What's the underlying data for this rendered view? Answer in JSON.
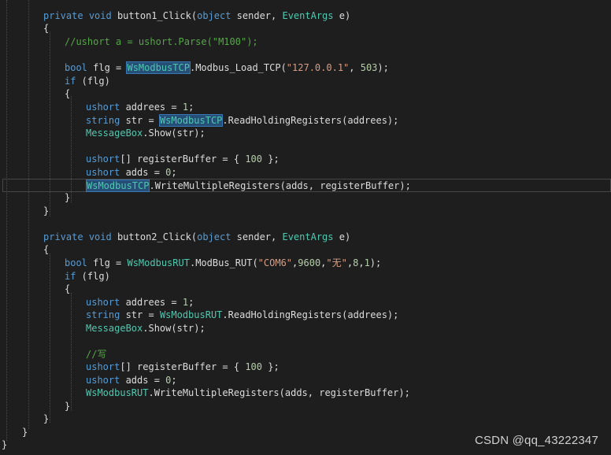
{
  "editor": {
    "lines": [
      [
        {
          "t": "private",
          "c": "kw"
        },
        {
          "t": " "
        },
        {
          "t": "void",
          "c": "kw"
        },
        {
          "t": " button1_Click("
        },
        {
          "t": "object",
          "c": "kw"
        },
        {
          "t": " sender, "
        },
        {
          "t": "EventArgs",
          "c": "ty"
        },
        {
          "t": " e)"
        }
      ],
      [
        {
          "t": "{"
        }
      ],
      [
        {
          "t": "//ushort a = ushort.Parse(\"M100\");",
          "c": "cm"
        }
      ],
      [],
      [
        {
          "t": "bool",
          "c": "kw"
        },
        {
          "t": " flg = "
        },
        {
          "t": "WsModbusTCP",
          "c": "hl"
        },
        {
          "t": ".Modbus_Load_TCP("
        },
        {
          "t": "\"127.0.0.1\"",
          "c": "st"
        },
        {
          "t": ", "
        },
        {
          "t": "503",
          "c": "nu"
        },
        {
          "t": ");"
        }
      ],
      [
        {
          "t": "if",
          "c": "kw"
        },
        {
          "t": " (flg)"
        }
      ],
      [
        {
          "t": "{"
        }
      ],
      [
        {
          "t": "ushort",
          "c": "kw"
        },
        {
          "t": " addrees = "
        },
        {
          "t": "1",
          "c": "nu"
        },
        {
          "t": ";"
        }
      ],
      [
        {
          "t": "string",
          "c": "kw"
        },
        {
          "t": " str = "
        },
        {
          "t": "WsModbusTCP",
          "c": "hl"
        },
        {
          "t": ".ReadHoldingRegisters(addrees);"
        }
      ],
      [
        {
          "t": "MessageBox",
          "c": "ty"
        },
        {
          "t": ".Show(str);"
        }
      ],
      [],
      [
        {
          "t": "ushort",
          "c": "kw"
        },
        {
          "t": "[] registerBuffer = { "
        },
        {
          "t": "100",
          "c": "nu"
        },
        {
          "t": " };"
        }
      ],
      [
        {
          "t": "ushort",
          "c": "kw"
        },
        {
          "t": " adds = "
        },
        {
          "t": "0",
          "c": "nu"
        },
        {
          "t": ";"
        }
      ],
      [
        {
          "t": "WsModbusTCP",
          "c": "hl"
        },
        {
          "t": ".WriteMultipleRegisters(adds, registerBuffer);"
        }
      ],
      [
        {
          "t": "}"
        }
      ],
      [
        {
          "t": "}"
        }
      ],
      [],
      [],
      [
        {
          "t": "private",
          "c": "kw"
        },
        {
          "t": " "
        },
        {
          "t": "void",
          "c": "kw"
        },
        {
          "t": " button2_Click("
        },
        {
          "t": "object",
          "c": "kw"
        },
        {
          "t": " sender, "
        },
        {
          "t": "EventArgs",
          "c": "ty"
        },
        {
          "t": " e)"
        }
      ],
      [
        {
          "t": "{"
        }
      ],
      [
        {
          "t": "bool",
          "c": "kw"
        },
        {
          "t": " flg = "
        },
        {
          "t": "WsModbusRUT",
          "c": "ty"
        },
        {
          "t": ".ModBus_RUT("
        },
        {
          "t": "\"COM6\"",
          "c": "st"
        },
        {
          "t": ","
        },
        {
          "t": "9600",
          "c": "nu"
        },
        {
          "t": ","
        },
        {
          "t": "\"无\"",
          "c": "st"
        },
        {
          "t": ","
        },
        {
          "t": "8",
          "c": "nu"
        },
        {
          "t": ","
        },
        {
          "t": "1",
          "c": "nu"
        },
        {
          "t": ");"
        }
      ],
      [
        {
          "t": "if",
          "c": "kw"
        },
        {
          "t": " (flg)"
        }
      ],
      [
        {
          "t": "{"
        }
      ],
      [
        {
          "t": "ushort",
          "c": "kw"
        },
        {
          "t": " addrees = "
        },
        {
          "t": "1",
          "c": "nu"
        },
        {
          "t": ";"
        }
      ],
      [
        {
          "t": "string",
          "c": "kw"
        },
        {
          "t": " str = "
        },
        {
          "t": "WsModbusRUT",
          "c": "ty"
        },
        {
          "t": ".ReadHoldingRegisters(addrees);"
        }
      ],
      [
        {
          "t": "MessageBox",
          "c": "ty"
        },
        {
          "t": ".Show(str);"
        }
      ],
      [],
      [
        {
          "t": "//写",
          "c": "cm"
        }
      ],
      [
        {
          "t": "ushort",
          "c": "kw"
        },
        {
          "t": "[] registerBuffer = { "
        },
        {
          "t": "100",
          "c": "nu"
        },
        {
          "t": " };"
        }
      ],
      [
        {
          "t": "ushort",
          "c": "kw"
        },
        {
          "t": " adds = "
        },
        {
          "t": "0",
          "c": "nu"
        },
        {
          "t": ";"
        }
      ],
      [
        {
          "t": "WsModbusRUT",
          "c": "ty"
        },
        {
          "t": ".WriteMultipleRegisters(adds, registerBuffer);"
        }
      ],
      [
        {
          "t": "}"
        }
      ],
      [
        {
          "t": "}"
        }
      ],
      [
        {
          "t": "}"
        }
      ],
      [
        {
          "t": "}"
        }
      ]
    ]
  },
  "watermark": "CSDN @qq_43222347",
  "colors": {
    "background": "#1e1e1e",
    "keyword": "#569cd6",
    "type": "#4ec9b0",
    "string": "#d69d85",
    "number": "#b5cea8",
    "comment": "#57a64a",
    "highlight": "#264f78"
  }
}
